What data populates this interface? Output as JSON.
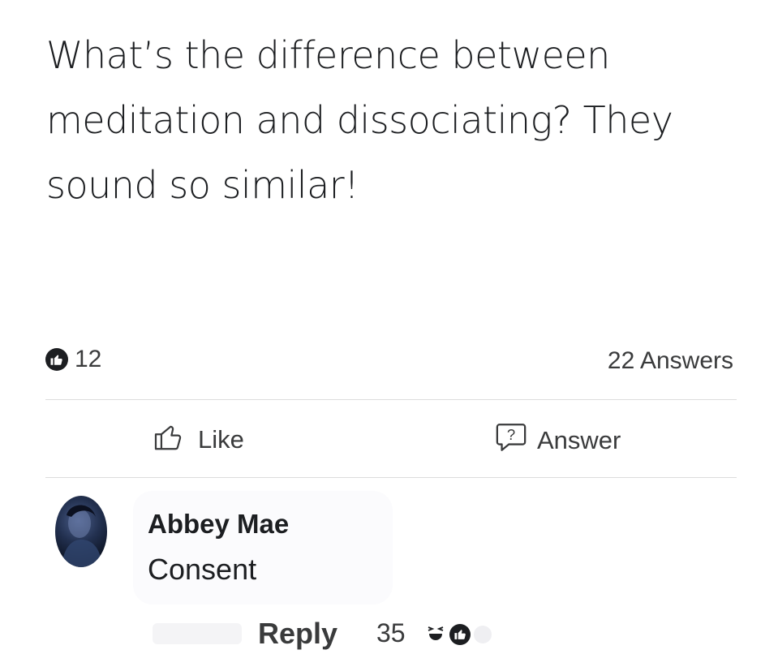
{
  "post": {
    "question": "What’s the difference between meditation and dissociating? They sound so similar!",
    "like_count": "12",
    "answers_count": "22 Answers"
  },
  "actions": {
    "like_label": "Like",
    "answer_label": "Answer"
  },
  "comment": {
    "author": "Abbey Mae",
    "text": "Consent",
    "reply_label": "Reply",
    "reaction_count": "35"
  },
  "icons": {
    "like_badge": "thumbs-up-icon",
    "like_button": "thumbs-up-outline-icon",
    "answer_button": "question-bubble-icon",
    "reactions": [
      "haha-emoji-icon",
      "thumbs-up-icon"
    ]
  },
  "colors": {
    "text": "#1c1e21",
    "secondary_text": "#3a3b3c",
    "divider": "#dcdcdc"
  }
}
